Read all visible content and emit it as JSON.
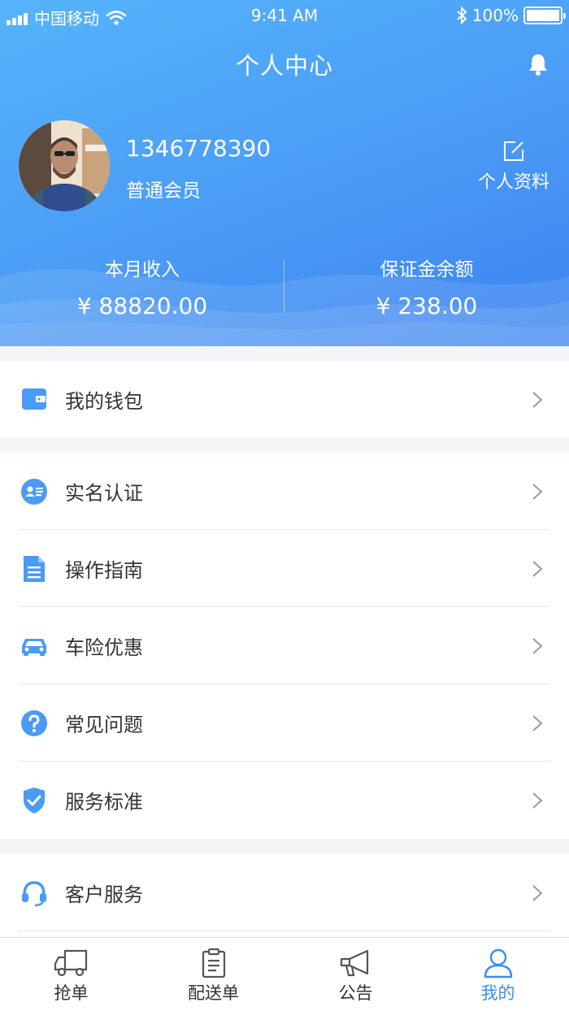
{
  "status_bar": {
    "carrier": "中国移动",
    "time": "9:41 AM",
    "battery": "100%"
  },
  "header": {
    "title": "个人中心",
    "phone": "1346778390",
    "member_level": "普通会员",
    "profile_link": "个人资料"
  },
  "stats": [
    {
      "label": "本月收入",
      "value": "¥ 88820.00"
    },
    {
      "label": "保证金余额",
      "value": "¥ 238.00"
    }
  ],
  "menu": {
    "wallet": "我的钱包",
    "items": [
      "实名认证",
      "操作指南",
      "车险优惠",
      "常见问题",
      "服务标准"
    ],
    "service": "客户服务"
  },
  "tabs": [
    {
      "label": "抢单",
      "icon": "truck-icon"
    },
    {
      "label": "配送单",
      "icon": "clipboard-icon"
    },
    {
      "label": "公告",
      "icon": "megaphone-icon"
    },
    {
      "label": "我的",
      "icon": "user-icon",
      "active": true
    }
  ],
  "colors": {
    "accent": "#3a8ef5",
    "header_gradient_start": "#55b4fb",
    "header_gradient_end": "#3b82f0"
  }
}
